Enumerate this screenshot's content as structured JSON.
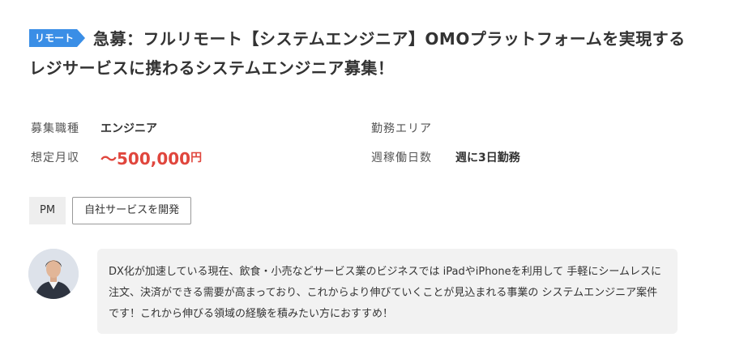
{
  "job": {
    "badge": "リモート",
    "title": "急募：フルリモート【システムエンジニア】OMOプラットフォームを実現するレジサービスに携わるシステムエンジニア募集！",
    "fields": {
      "occupation_label": "募集職種",
      "occupation_value": "エンジニア",
      "salary_label": "想定月収",
      "salary_value": "〜500,000",
      "salary_unit": "円",
      "area_label": "勤務エリア",
      "area_value": "",
      "days_label": "週稼働日数",
      "days_value": "週に3日勤務"
    },
    "tags": [
      "PM",
      "自社サービスを開発"
    ],
    "comment": "DX化が加速している現在、飲食・小売などサービス業のビジネスでは iPadやiPhoneを利用して 手軽にシームレスに注文、決済ができる需要が高まっており、これからより伸びていくことが見込まれる事業の システムエンジニア案件です！これから伸びる領域の経験を積みたい方におすすめ！"
  },
  "colors": {
    "badge": "#3a8ee6",
    "salary": "#e0463d",
    "comment_bg": "#f2f2f2"
  },
  "icons": {
    "avatar": "person-avatar"
  }
}
